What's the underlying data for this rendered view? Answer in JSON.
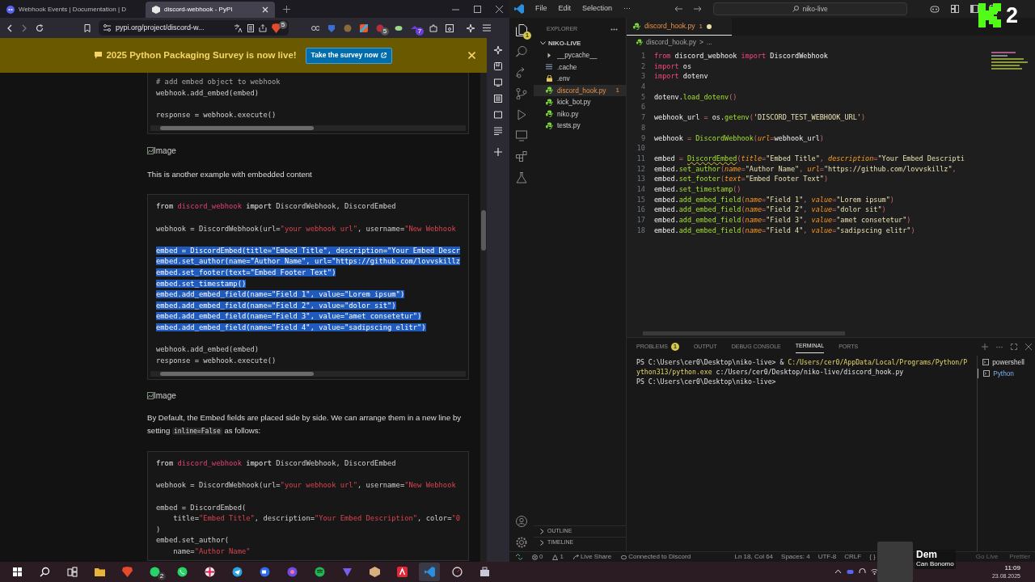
{
  "browser": {
    "tabs": [
      {
        "title": "Webhook Events | Documentation | D",
        "selected": false
      },
      {
        "title": "discord-webhook - PyPI",
        "selected": true
      }
    ],
    "url": "pypi.org/project/discord-w...",
    "shield_badge": "5",
    "extension_badges": [
      "5",
      "7"
    ],
    "banner": {
      "text": "2025 Python Packaging Survey is now live!",
      "button": "Take the survey now"
    },
    "content": [
      {
        "kind": "code",
        "scrollbar": true,
        "lines": [
          {
            "kind": "code",
            "s": [
              {
                "t": "# add embed object to webhook",
                "kind": "comment"
              }
            ]
          },
          {
            "kind": "code",
            "s": [
              {
                "t": "webhook.add_embed(embed)",
                "kind": "plain"
              }
            ]
          },
          {
            "kind": "blank"
          },
          {
            "kind": "code",
            "s": [
              {
                "t": "response = webhook.execute()",
                "kind": "plain"
              }
            ]
          }
        ]
      },
      {
        "kind": "image",
        "alt": "Image"
      },
      {
        "kind": "text",
        "parts": [
          {
            "kind": "plain",
            "text": "This is another example with embedded content"
          }
        ]
      },
      {
        "kind": "code",
        "scrollbar": true,
        "lines": [
          {
            "kind": "code",
            "selected": false,
            "s": [
              {
                "t": "from",
                "kind": "keyword"
              },
              {
                "t": " discord_webhook ",
                "kind": "module"
              },
              {
                "t": "import",
                "kind": "keyword"
              },
              {
                "t": " DiscordWebhook, DiscordEmbed",
                "kind": "plain"
              }
            ]
          },
          {
            "kind": "blank"
          },
          {
            "kind": "code",
            "selected": false,
            "s": [
              {
                "t": "webhook = DiscordWebhook(url=",
                "kind": "plain"
              },
              {
                "t": "\"your webhook url\"",
                "kind": "string"
              },
              {
                "t": ", username=",
                "kind": "plain"
              },
              {
                "t": "\"New Webhook",
                "kind": "string"
              }
            ]
          },
          {
            "kind": "blank"
          },
          {
            "kind": "code",
            "selected": true,
            "s": [
              {
                "t": "embed = DiscordEmbed(title=\"Embed Title\", description=\"Your Embed Descr",
                "kind": "plain"
              }
            ]
          },
          {
            "kind": "code",
            "selected": true,
            "s": [
              {
                "t": "embed.set_author(name=\"Author Name\", url=\"https://github.com/lovvskillz",
                "kind": "plain"
              }
            ]
          },
          {
            "kind": "code",
            "selected": true,
            "s": [
              {
                "t": "embed.set_footer(text=\"Embed Footer Text\")",
                "kind": "plain"
              }
            ]
          },
          {
            "kind": "code",
            "selected": true,
            "s": [
              {
                "t": "embed.set_timestamp()",
                "kind": "plain"
              }
            ]
          },
          {
            "kind": "code",
            "selected": true,
            "s": [
              {
                "t": "embed.add_embed_field(name=\"Field 1\", value=\"Lorem ipsum\")",
                "kind": "plain"
              }
            ]
          },
          {
            "kind": "code",
            "selected": true,
            "s": [
              {
                "t": "embed.add_embed_field(name=\"Field 2\", value=\"dolor sit\")",
                "kind": "plain"
              }
            ]
          },
          {
            "kind": "code",
            "selected": true,
            "s": [
              {
                "t": "embed.add_embed_field(name=\"Field 3\", value=\"amet consetetur\")",
                "kind": "plain"
              }
            ]
          },
          {
            "kind": "code",
            "selected": true,
            "s": [
              {
                "t": "embed.add_embed_field(name=\"Field 4\", value=\"sadipscing elitr\")",
                "kind": "plain"
              }
            ]
          },
          {
            "kind": "blank"
          },
          {
            "kind": "code",
            "selected": false,
            "s": [
              {
                "t": "webhook.add_embed(embed)",
                "kind": "plain"
              }
            ]
          },
          {
            "kind": "code",
            "selected": false,
            "s": [
              {
                "t": "response = webhook.execute()",
                "kind": "plain"
              }
            ]
          }
        ]
      },
      {
        "kind": "image",
        "alt": "Image"
      },
      {
        "kind": "text",
        "parts": [
          {
            "kind": "plain",
            "text": "By Default, the Embed fields are placed side by side. We can arrange them in a new line by setting "
          },
          {
            "kind": "code",
            "text": "inline=False"
          },
          {
            "kind": "plain",
            "text": " as follows:"
          }
        ]
      },
      {
        "kind": "code",
        "scrollbar": false,
        "lines": [
          {
            "kind": "code",
            "s": [
              {
                "t": "from",
                "kind": "keyword"
              },
              {
                "t": " discord_webhook ",
                "kind": "module"
              },
              {
                "t": "import",
                "kind": "keyword"
              },
              {
                "t": " DiscordWebhook, DiscordEmbed",
                "kind": "plain"
              }
            ]
          },
          {
            "kind": "blank"
          },
          {
            "kind": "code",
            "s": [
              {
                "t": "webhook = DiscordWebhook(url=",
                "kind": "plain"
              },
              {
                "t": "\"your webhook url\"",
                "kind": "string"
              },
              {
                "t": ", username=",
                "kind": "plain"
              },
              {
                "t": "\"New Webhook",
                "kind": "string"
              }
            ]
          },
          {
            "kind": "blank"
          },
          {
            "kind": "code",
            "s": [
              {
                "t": "embed = DiscordEmbed(",
                "kind": "plain"
              }
            ]
          },
          {
            "kind": "code",
            "s": [
              {
                "t": "    title=",
                "kind": "plain"
              },
              {
                "t": "\"Embed Title\"",
                "kind": "string"
              },
              {
                "t": ", description=",
                "kind": "plain"
              },
              {
                "t": "\"Your Embed Description\"",
                "kind": "string"
              },
              {
                "t": ", color=",
                "kind": "plain"
              },
              {
                "t": "\"0",
                "kind": "string"
              }
            ]
          },
          {
            "kind": "code",
            "s": [
              {
                "t": ")",
                "kind": "plain"
              }
            ]
          },
          {
            "kind": "code",
            "s": [
              {
                "t": "embed.set_author(",
                "kind": "plain"
              }
            ]
          },
          {
            "kind": "code",
            "s": [
              {
                "t": "    name=",
                "kind": "plain"
              },
              {
                "t": "\"Author Name\"",
                "kind": "string"
              }
            ]
          }
        ]
      }
    ]
  },
  "vscode": {
    "menu": [
      "File",
      "Edit",
      "Selection",
      "···"
    ],
    "search": "niko-live",
    "explorer_badge": "1",
    "explorer": {
      "title": "EXPLORER",
      "folder": "NIKO-LIVE",
      "files": [
        {
          "name": "__pycache__",
          "kind": "folder",
          "selected": false
        },
        {
          "name": ".cache",
          "kind": "text",
          "selected": false
        },
        {
          "name": ".env",
          "kind": "lock",
          "selected": false
        },
        {
          "name": "discord_hook.py",
          "kind": "python",
          "selected": true,
          "badge": "1"
        },
        {
          "name": "kick_bot.py",
          "kind": "python",
          "selected": false
        },
        {
          "name": "niko.py",
          "kind": "python",
          "selected": false
        },
        {
          "name": "tests.py",
          "kind": "python",
          "selected": false
        }
      ],
      "sections": [
        "OUTLINE",
        "TIMELINE"
      ]
    },
    "tab": {
      "name": "discord_hook.py",
      "badge": "1",
      "modified": true
    },
    "breadcrumb": [
      "discord_hook.py",
      ">",
      "..."
    ],
    "lines": [
      {
        "n": "1",
        "s": [
          {
            "t": "from",
            "kind": "keyword"
          },
          {
            "t": " discord_webhook ",
            "kind": "name"
          },
          {
            "t": "import",
            "kind": "keyword"
          },
          {
            "t": " DiscordWebhook",
            "kind": "name"
          }
        ]
      },
      {
        "n": "2",
        "s": [
          {
            "t": "import",
            "kind": "keyword"
          },
          {
            "t": " os",
            "kind": "name"
          }
        ]
      },
      {
        "n": "3",
        "s": [
          {
            "t": "import",
            "kind": "keyword"
          },
          {
            "t": " dotenv",
            "kind": "name"
          }
        ]
      },
      {
        "n": "4"
      },
      {
        "n": "5",
        "s": [
          {
            "t": "dotenv.",
            "kind": "name"
          },
          {
            "t": "load_dotenv",
            "kind": "func"
          },
          {
            "t": "()",
            "kind": "punct"
          }
        ]
      },
      {
        "n": "6"
      },
      {
        "n": "7",
        "s": [
          {
            "t": "webhook_url ",
            "kind": "name"
          },
          {
            "t": "= ",
            "kind": "punct"
          },
          {
            "t": "os.",
            "kind": "name"
          },
          {
            "t": "getenv",
            "kind": "func"
          },
          {
            "t": "(",
            "kind": "punct"
          },
          {
            "t": "'DISCORD_TEST_WEBHOOK_URL'",
            "kind": "string"
          },
          {
            "t": ")",
            "kind": "punct"
          }
        ]
      },
      {
        "n": "8"
      },
      {
        "n": "9",
        "s": [
          {
            "t": "webhook ",
            "kind": "name"
          },
          {
            "t": "= ",
            "kind": "punct"
          },
          {
            "t": "DiscordWebhook",
            "kind": "func"
          },
          {
            "t": "(",
            "kind": "punct"
          },
          {
            "t": "url",
            "kind": "param"
          },
          {
            "t": "=",
            "kind": "punct"
          },
          {
            "t": "webhook_url",
            "kind": "name"
          },
          {
            "t": ")",
            "kind": "punct"
          }
        ]
      },
      {
        "n": "10"
      },
      {
        "n": "11",
        "s": [
          {
            "t": "embed ",
            "kind": "name"
          },
          {
            "t": "= ",
            "kind": "punct"
          },
          {
            "t": "DiscordEmbed",
            "kind": "warning"
          },
          {
            "t": "(",
            "kind": "punct"
          },
          {
            "t": "title",
            "kind": "param"
          },
          {
            "t": "=",
            "kind": "punct"
          },
          {
            "t": "\"Embed Title\"",
            "kind": "string"
          },
          {
            "t": ", ",
            "kind": "punct"
          },
          {
            "t": "description",
            "kind": "param"
          },
          {
            "t": "=",
            "kind": "punct"
          },
          {
            "t": "\"Your Embed Descripti",
            "kind": "string"
          }
        ]
      },
      {
        "n": "12",
        "s": [
          {
            "t": "embed.",
            "kind": "name"
          },
          {
            "t": "set_author",
            "kind": "func"
          },
          {
            "t": "(",
            "kind": "punct"
          },
          {
            "t": "name",
            "kind": "param"
          },
          {
            "t": "=",
            "kind": "punct"
          },
          {
            "t": "\"Author Name\"",
            "kind": "string"
          },
          {
            "t": ", ",
            "kind": "punct"
          },
          {
            "t": "url",
            "kind": "param"
          },
          {
            "t": "=",
            "kind": "punct"
          },
          {
            "t": "\"https://github.com/lovvskillz\"",
            "kind": "string"
          },
          {
            "t": ",",
            "kind": "punct"
          }
        ]
      },
      {
        "n": "13",
        "s": [
          {
            "t": "embed.",
            "kind": "name"
          },
          {
            "t": "set_footer",
            "kind": "func"
          },
          {
            "t": "(",
            "kind": "punct"
          },
          {
            "t": "text",
            "kind": "param"
          },
          {
            "t": "=",
            "kind": "punct"
          },
          {
            "t": "\"Embed Footer Text\"",
            "kind": "string"
          },
          {
            "t": ")",
            "kind": "punct"
          }
        ]
      },
      {
        "n": "14",
        "s": [
          {
            "t": "embed.",
            "kind": "name"
          },
          {
            "t": "set_timestamp",
            "kind": "func"
          },
          {
            "t": "()",
            "kind": "punct"
          }
        ]
      },
      {
        "n": "15",
        "s": [
          {
            "t": "embed.",
            "kind": "name"
          },
          {
            "t": "add_embed_field",
            "kind": "func"
          },
          {
            "t": "(",
            "kind": "punct"
          },
          {
            "t": "name",
            "kind": "param"
          },
          {
            "t": "=",
            "kind": "punct"
          },
          {
            "t": "\"Field 1\"",
            "kind": "string"
          },
          {
            "t": ", ",
            "kind": "punct"
          },
          {
            "t": "value",
            "kind": "param"
          },
          {
            "t": "=",
            "kind": "punct"
          },
          {
            "t": "\"Lorem ipsum\"",
            "kind": "string"
          },
          {
            "t": ")",
            "kind": "punct"
          }
        ]
      },
      {
        "n": "16",
        "s": [
          {
            "t": "embed.",
            "kind": "name"
          },
          {
            "t": "add_embed_field",
            "kind": "func"
          },
          {
            "t": "(",
            "kind": "punct"
          },
          {
            "t": "name",
            "kind": "param"
          },
          {
            "t": "=",
            "kind": "punct"
          },
          {
            "t": "\"Field 2\"",
            "kind": "string"
          },
          {
            "t": ", ",
            "kind": "punct"
          },
          {
            "t": "value",
            "kind": "param"
          },
          {
            "t": "=",
            "kind": "punct"
          },
          {
            "t": "\"dolor sit\"",
            "kind": "string"
          },
          {
            "t": ")",
            "kind": "punct"
          }
        ]
      },
      {
        "n": "17",
        "s": [
          {
            "t": "embed.",
            "kind": "name"
          },
          {
            "t": "add_embed_field",
            "kind": "func"
          },
          {
            "t": "(",
            "kind": "punct"
          },
          {
            "t": "name",
            "kind": "param"
          },
          {
            "t": "=",
            "kind": "punct"
          },
          {
            "t": "\"Field 3\"",
            "kind": "string"
          },
          {
            "t": ", ",
            "kind": "punct"
          },
          {
            "t": "value",
            "kind": "param"
          },
          {
            "t": "=",
            "kind": "punct"
          },
          {
            "t": "\"amet consetetur\"",
            "kind": "string"
          },
          {
            "t": ")",
            "kind": "punct"
          }
        ]
      },
      {
        "n": "18",
        "s": [
          {
            "t": "embed.",
            "kind": "name"
          },
          {
            "t": "add_embed_field",
            "kind": "func"
          },
          {
            "t": "(",
            "kind": "punct"
          },
          {
            "t": "name",
            "kind": "param"
          },
          {
            "t": "=",
            "kind": "punct"
          },
          {
            "t": "\"Field 4\"",
            "kind": "string"
          },
          {
            "t": ", ",
            "kind": "punct"
          },
          {
            "t": "value",
            "kind": "param"
          },
          {
            "t": "=",
            "kind": "punct"
          },
          {
            "t": "\"sadipscing elitr\"",
            "kind": "string"
          },
          {
            "t": ")",
            "kind": "punct"
          }
        ]
      }
    ],
    "panel_tabs": [
      {
        "label": "PROBLEMS",
        "selected": false,
        "badge": "1"
      },
      {
        "label": "OUTPUT",
        "selected": false
      },
      {
        "label": "DEBUG CONSOLE",
        "selected": false
      },
      {
        "label": "TERMINAL",
        "selected": true
      },
      {
        "label": "PORTS",
        "selected": false
      }
    ],
    "terminal": [
      [
        {
          "t": "PS C:\\Users\\cer0\\Desktop\\niko-live> & ",
          "kind": "plain"
        },
        {
          "t": "C:/Users/cer0/AppData/Local/Programs/Python/P",
          "kind": "path"
        }
      ],
      [
        {
          "t": "ython313/python.exe",
          "kind": "path"
        },
        {
          "t": " c:/Users/cer0/Desktop/niko-live/discord_hook.py",
          "kind": "plain"
        }
      ],
      [
        {
          "t": "PS C:\\Users\\cer0\\Desktop\\niko-live>",
          "kind": "plain"
        }
      ]
    ],
    "shells": [
      {
        "name": "powershell",
        "selected": false
      },
      {
        "name": "Python",
        "selected": true
      }
    ],
    "status_left": [
      {
        "kind": "errors",
        "text": "0"
      },
      {
        "kind": "warnings",
        "text": "1"
      },
      {
        "kind": "share",
        "text": "Live Share"
      },
      {
        "kind": "discord",
        "text": "Connected to Discord"
      }
    ],
    "status_right": [
      "Ln 18, Col 64",
      "Spaces: 4",
      "UTF-8",
      "CRLF",
      "{ }"
    ],
    "status_far": [
      "Go Live",
      "Prettier"
    ]
  },
  "overlay": {
    "count": "2",
    "name": "Dem",
    "subtitle": "Can Bonomo"
  },
  "taskbar": {
    "badge": "2",
    "time": "11:09",
    "date": "23.08.2025"
  }
}
